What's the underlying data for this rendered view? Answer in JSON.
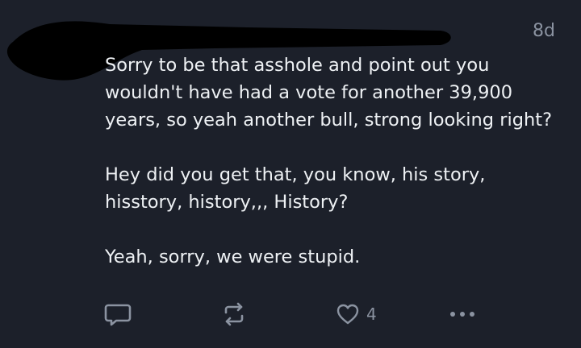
{
  "post": {
    "timestamp": "8d",
    "paragraphs": [
      "Sorry to be that asshole and point out you wouldn't have had a vote for another 39,900 years, so yeah another bull, strong looking right?",
      "Hey did you get that, you know, his story, hisstory, history,,, History?",
      "Yeah, sorry, we were stupid."
    ]
  },
  "actions": {
    "reply_icon": "reply-icon",
    "repost_icon": "repost-icon",
    "like_icon": "heart-icon",
    "like_count": "4",
    "more_icon": "more-horizontal-icon"
  },
  "colors": {
    "background": "#1c202a",
    "text": "#eef1f4",
    "muted": "#8b93a1"
  }
}
